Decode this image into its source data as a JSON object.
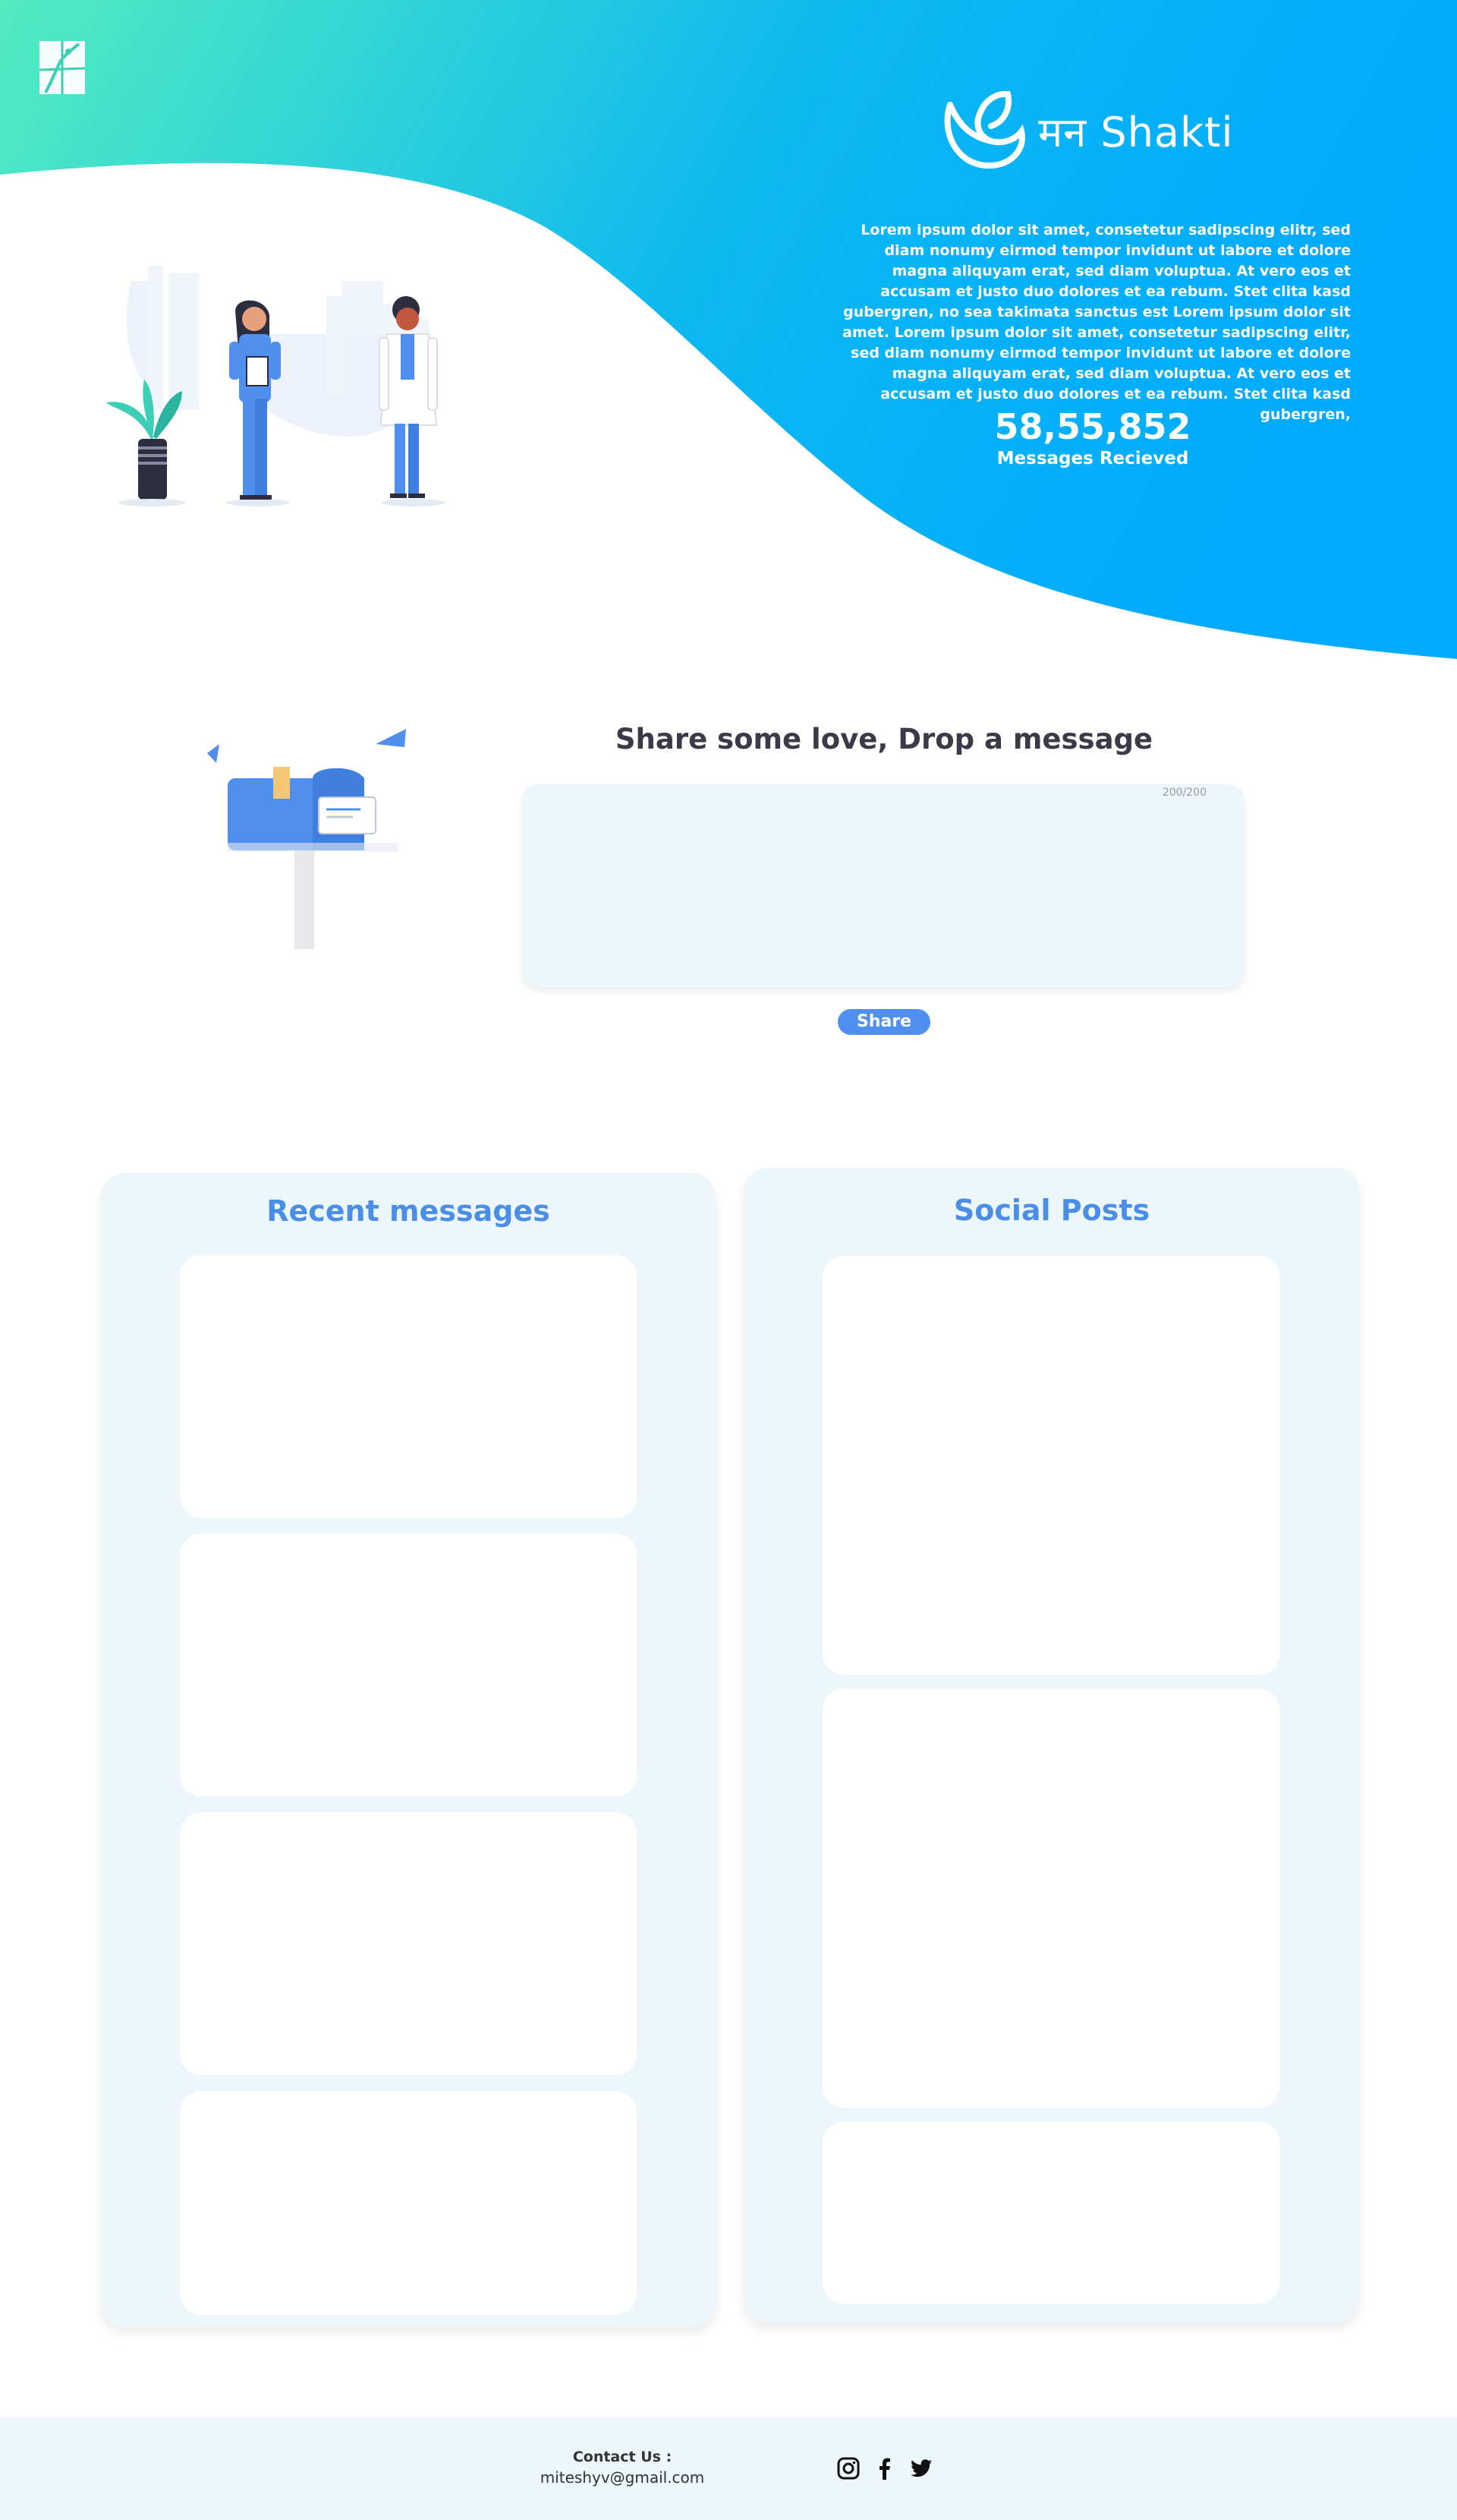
{
  "brand": {
    "name": "मन Shakti",
    "description": "Lorem ipsum dolor sit amet, consetetur sadipscing elitr, sed diam nonumy eirmod tempor invidunt ut labore et dolore magna aliquyam erat, sed diam voluptua. At vero eos et accusam et justo duo dolores et ea rebum. Stet clita kasd gubergren, no sea takimata sanctus est Lorem ipsum dolor sit amet. Lorem ipsum dolor sit amet, consetetur sadipscing elitr, sed diam nonumy eirmod tempor invidunt ut labore et dolore magna aliquyam erat, sed diam voluptua. At vero eos et accusam et justo duo dolores et ea rebum. Stet clita kasd gubergren,"
  },
  "counter": {
    "value": "58,55,852",
    "label": "Messages Recieved"
  },
  "share": {
    "title": "Share some love, Drop a message",
    "char_count": "200/200",
    "button_label": "Share"
  },
  "recent": {
    "title": "Recent messages",
    "cards": 4
  },
  "social": {
    "title": "Social Posts",
    "cards": 3
  },
  "footer": {
    "contact_title": "Contact Us :",
    "email": "miteshyv@gmail.com",
    "icons": [
      "instagram-icon",
      "facebook-icon",
      "twitter-icon"
    ]
  },
  "colors": {
    "gradient_start": "#52ecc0",
    "gradient_end": "#00aaff",
    "accent": "#4a8ee8",
    "panel_bg": "#edf7fb"
  }
}
